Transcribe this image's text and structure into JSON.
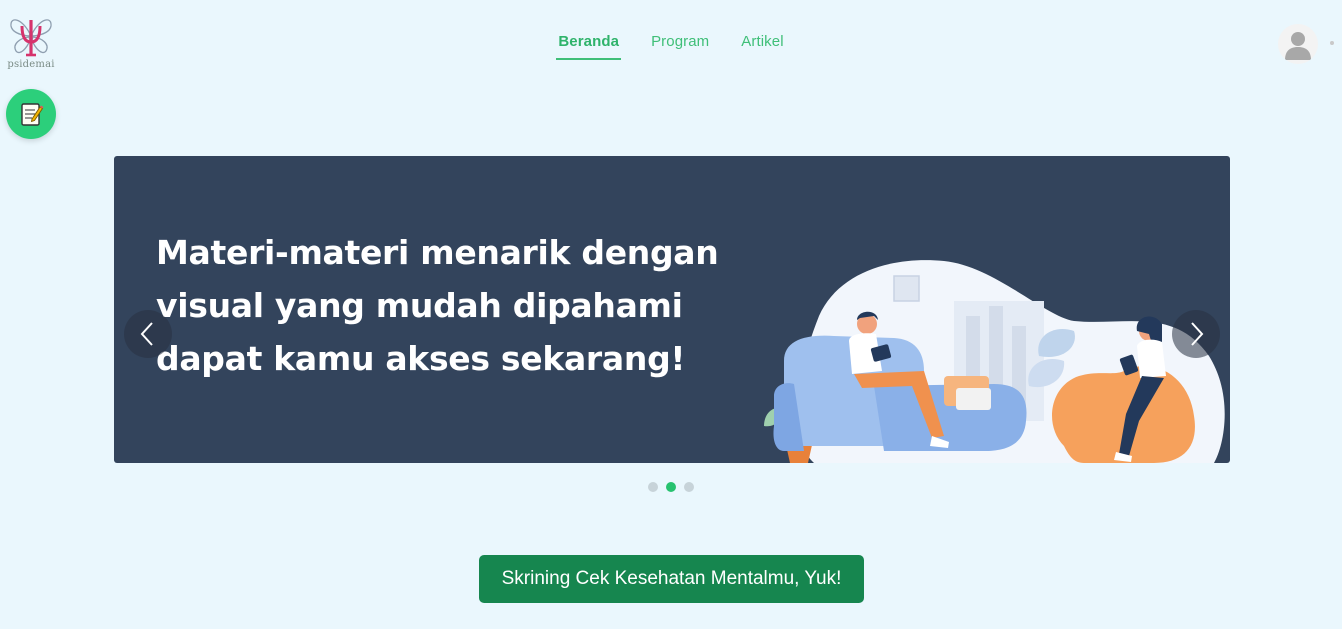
{
  "logo": {
    "text": "psidemai"
  },
  "note_button": {
    "icon": "memo-icon"
  },
  "nav": {
    "items": [
      {
        "label": "Beranda",
        "active": true
      },
      {
        "label": "Program",
        "active": false
      },
      {
        "label": "Artikel",
        "active": false
      }
    ]
  },
  "user": {
    "icon": "user-avatar-icon"
  },
  "carousel": {
    "heading_line1": "Materi-materi menarik dengan",
    "heading_line2": "visual yang mudah dipahami",
    "heading_line3": "dapat kamu akses sekarang!",
    "prev_icon": "chevron-left-icon",
    "next_icon": "chevron-right-icon",
    "slide_count": 3,
    "active_slide": 2
  },
  "cta": {
    "label": "Skrining Cek Kesehatan Mentalmu, Yuk!"
  },
  "colors": {
    "page_background": "#eaf7fd",
    "accent_green": "#3fbf78",
    "banner_background": "#33445c",
    "cta_background": "#16864f"
  }
}
